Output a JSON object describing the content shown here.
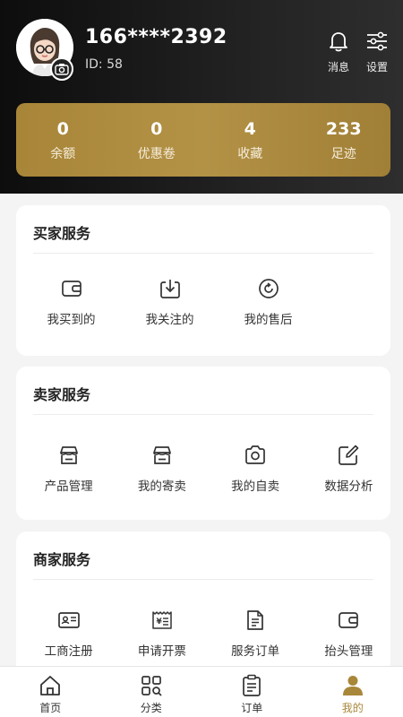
{
  "user": {
    "phone": "166****2392",
    "id_text": "ID: 58"
  },
  "header_actions": {
    "messages_label": "消息",
    "settings_label": "设置"
  },
  "stats": [
    {
      "value": "0",
      "label": "余额"
    },
    {
      "value": "0",
      "label": "优惠卷"
    },
    {
      "value": "4",
      "label": "收藏"
    },
    {
      "value": "233",
      "label": "足迹"
    }
  ],
  "buyer_services": {
    "title": "买家服务",
    "items": [
      {
        "label": "我买到的",
        "icon": "wallet-icon"
      },
      {
        "label": "我关注的",
        "icon": "download-box-icon"
      },
      {
        "label": "我的售后",
        "icon": "refresh-circle-icon"
      }
    ]
  },
  "seller_services": {
    "title": "卖家服务",
    "items": [
      {
        "label": "产品管理",
        "icon": "store-icon"
      },
      {
        "label": "我的寄卖",
        "icon": "store-icon"
      },
      {
        "label": "我的自卖",
        "icon": "camera-icon"
      },
      {
        "label": "数据分析",
        "icon": "edit-icon"
      }
    ]
  },
  "merchant_services": {
    "title": "商家服务",
    "items": [
      {
        "label": "工商注册",
        "icon": "id-card-icon"
      },
      {
        "label": "申请开票",
        "icon": "invoice-icon"
      },
      {
        "label": "服务订单",
        "icon": "document-icon"
      },
      {
        "label": "抬头管理",
        "icon": "wallet-icon"
      }
    ]
  },
  "tabbar": [
    {
      "label": "首页",
      "icon": "home-icon"
    },
    {
      "label": "分类",
      "icon": "category-icon"
    },
    {
      "label": "订单",
      "icon": "clipboard-icon"
    },
    {
      "label": "我的",
      "icon": "person-icon",
      "active": true
    }
  ],
  "colors": {
    "accent": "#a8873a",
    "header_bg": "#111111"
  }
}
